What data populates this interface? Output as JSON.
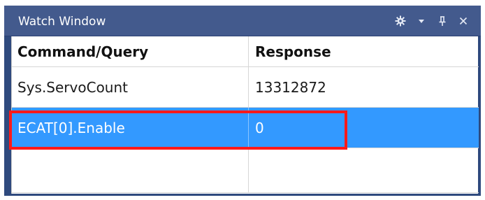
{
  "window": {
    "title": "Watch Window"
  },
  "controls": {
    "settings_icon": "gear-icon",
    "dropdown_icon": "chevron-down-icon",
    "pin_icon": "pin-icon",
    "close_icon": "close-icon"
  },
  "table": {
    "columns": [
      "Command/Query",
      "Response"
    ],
    "rows": [
      {
        "command": "Sys.ServoCount",
        "response": "13312872"
      },
      {
        "command": "ECAT[0].Enable",
        "response": "0",
        "selected": true
      },
      {
        "command": "",
        "response": ""
      }
    ]
  },
  "colors": {
    "titlebar": "#435a8d",
    "selection": "#3399ff",
    "highlight_box": "#ff1a1a"
  }
}
